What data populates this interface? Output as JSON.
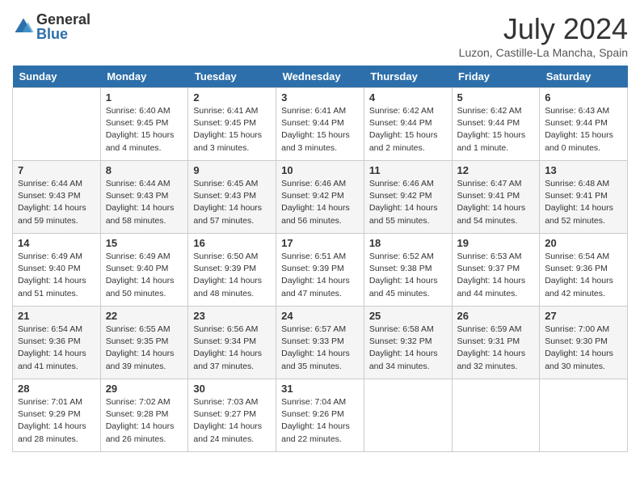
{
  "logo": {
    "general": "General",
    "blue": "Blue"
  },
  "title": "July 2024",
  "location": "Luzon, Castille-La Mancha, Spain",
  "days_of_week": [
    "Sunday",
    "Monday",
    "Tuesday",
    "Wednesday",
    "Thursday",
    "Friday",
    "Saturday"
  ],
  "weeks": [
    [
      {
        "num": "",
        "sunrise": "",
        "sunset": "",
        "daylight": ""
      },
      {
        "num": "1",
        "sunrise": "Sunrise: 6:40 AM",
        "sunset": "Sunset: 9:45 PM",
        "daylight": "Daylight: 15 hours and 4 minutes."
      },
      {
        "num": "2",
        "sunrise": "Sunrise: 6:41 AM",
        "sunset": "Sunset: 9:45 PM",
        "daylight": "Daylight: 15 hours and 3 minutes."
      },
      {
        "num": "3",
        "sunrise": "Sunrise: 6:41 AM",
        "sunset": "Sunset: 9:44 PM",
        "daylight": "Daylight: 15 hours and 3 minutes."
      },
      {
        "num": "4",
        "sunrise": "Sunrise: 6:42 AM",
        "sunset": "Sunset: 9:44 PM",
        "daylight": "Daylight: 15 hours and 2 minutes."
      },
      {
        "num": "5",
        "sunrise": "Sunrise: 6:42 AM",
        "sunset": "Sunset: 9:44 PM",
        "daylight": "Daylight: 15 hours and 1 minute."
      },
      {
        "num": "6",
        "sunrise": "Sunrise: 6:43 AM",
        "sunset": "Sunset: 9:44 PM",
        "daylight": "Daylight: 15 hours and 0 minutes."
      }
    ],
    [
      {
        "num": "7",
        "sunrise": "Sunrise: 6:44 AM",
        "sunset": "Sunset: 9:43 PM",
        "daylight": "Daylight: 14 hours and 59 minutes."
      },
      {
        "num": "8",
        "sunrise": "Sunrise: 6:44 AM",
        "sunset": "Sunset: 9:43 PM",
        "daylight": "Daylight: 14 hours and 58 minutes."
      },
      {
        "num": "9",
        "sunrise": "Sunrise: 6:45 AM",
        "sunset": "Sunset: 9:43 PM",
        "daylight": "Daylight: 14 hours and 57 minutes."
      },
      {
        "num": "10",
        "sunrise": "Sunrise: 6:46 AM",
        "sunset": "Sunset: 9:42 PM",
        "daylight": "Daylight: 14 hours and 56 minutes."
      },
      {
        "num": "11",
        "sunrise": "Sunrise: 6:46 AM",
        "sunset": "Sunset: 9:42 PM",
        "daylight": "Daylight: 14 hours and 55 minutes."
      },
      {
        "num": "12",
        "sunrise": "Sunrise: 6:47 AM",
        "sunset": "Sunset: 9:41 PM",
        "daylight": "Daylight: 14 hours and 54 minutes."
      },
      {
        "num": "13",
        "sunrise": "Sunrise: 6:48 AM",
        "sunset": "Sunset: 9:41 PM",
        "daylight": "Daylight: 14 hours and 52 minutes."
      }
    ],
    [
      {
        "num": "14",
        "sunrise": "Sunrise: 6:49 AM",
        "sunset": "Sunset: 9:40 PM",
        "daylight": "Daylight: 14 hours and 51 minutes."
      },
      {
        "num": "15",
        "sunrise": "Sunrise: 6:49 AM",
        "sunset": "Sunset: 9:40 PM",
        "daylight": "Daylight: 14 hours and 50 minutes."
      },
      {
        "num": "16",
        "sunrise": "Sunrise: 6:50 AM",
        "sunset": "Sunset: 9:39 PM",
        "daylight": "Daylight: 14 hours and 48 minutes."
      },
      {
        "num": "17",
        "sunrise": "Sunrise: 6:51 AM",
        "sunset": "Sunset: 9:39 PM",
        "daylight": "Daylight: 14 hours and 47 minutes."
      },
      {
        "num": "18",
        "sunrise": "Sunrise: 6:52 AM",
        "sunset": "Sunset: 9:38 PM",
        "daylight": "Daylight: 14 hours and 45 minutes."
      },
      {
        "num": "19",
        "sunrise": "Sunrise: 6:53 AM",
        "sunset": "Sunset: 9:37 PM",
        "daylight": "Daylight: 14 hours and 44 minutes."
      },
      {
        "num": "20",
        "sunrise": "Sunrise: 6:54 AM",
        "sunset": "Sunset: 9:36 PM",
        "daylight": "Daylight: 14 hours and 42 minutes."
      }
    ],
    [
      {
        "num": "21",
        "sunrise": "Sunrise: 6:54 AM",
        "sunset": "Sunset: 9:36 PM",
        "daylight": "Daylight: 14 hours and 41 minutes."
      },
      {
        "num": "22",
        "sunrise": "Sunrise: 6:55 AM",
        "sunset": "Sunset: 9:35 PM",
        "daylight": "Daylight: 14 hours and 39 minutes."
      },
      {
        "num": "23",
        "sunrise": "Sunrise: 6:56 AM",
        "sunset": "Sunset: 9:34 PM",
        "daylight": "Daylight: 14 hours and 37 minutes."
      },
      {
        "num": "24",
        "sunrise": "Sunrise: 6:57 AM",
        "sunset": "Sunset: 9:33 PM",
        "daylight": "Daylight: 14 hours and 35 minutes."
      },
      {
        "num": "25",
        "sunrise": "Sunrise: 6:58 AM",
        "sunset": "Sunset: 9:32 PM",
        "daylight": "Daylight: 14 hours and 34 minutes."
      },
      {
        "num": "26",
        "sunrise": "Sunrise: 6:59 AM",
        "sunset": "Sunset: 9:31 PM",
        "daylight": "Daylight: 14 hours and 32 minutes."
      },
      {
        "num": "27",
        "sunrise": "Sunrise: 7:00 AM",
        "sunset": "Sunset: 9:30 PM",
        "daylight": "Daylight: 14 hours and 30 minutes."
      }
    ],
    [
      {
        "num": "28",
        "sunrise": "Sunrise: 7:01 AM",
        "sunset": "Sunset: 9:29 PM",
        "daylight": "Daylight: 14 hours and 28 minutes."
      },
      {
        "num": "29",
        "sunrise": "Sunrise: 7:02 AM",
        "sunset": "Sunset: 9:28 PM",
        "daylight": "Daylight: 14 hours and 26 minutes."
      },
      {
        "num": "30",
        "sunrise": "Sunrise: 7:03 AM",
        "sunset": "Sunset: 9:27 PM",
        "daylight": "Daylight: 14 hours and 24 minutes."
      },
      {
        "num": "31",
        "sunrise": "Sunrise: 7:04 AM",
        "sunset": "Sunset: 9:26 PM",
        "daylight": "Daylight: 14 hours and 22 minutes."
      },
      {
        "num": "",
        "sunrise": "",
        "sunset": "",
        "daylight": ""
      },
      {
        "num": "",
        "sunrise": "",
        "sunset": "",
        "daylight": ""
      },
      {
        "num": "",
        "sunrise": "",
        "sunset": "",
        "daylight": ""
      }
    ]
  ]
}
